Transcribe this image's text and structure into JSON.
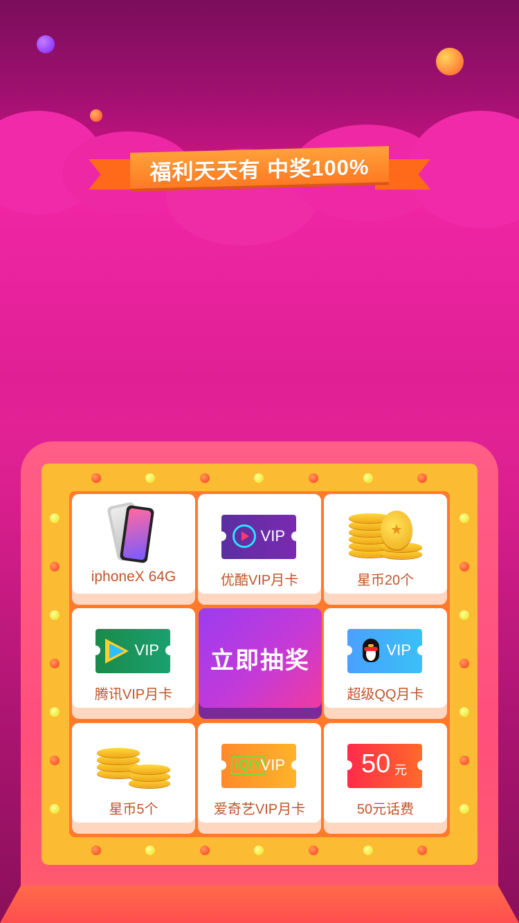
{
  "banner": {
    "text": "福利天天有 中奖100%"
  },
  "draw_button": {
    "label": "立即抽奖"
  },
  "prizes": [
    {
      "label": "iphoneX 64G",
      "icon": "iphone-icon"
    },
    {
      "label": "优酷VIP月卡",
      "icon": "youku-vip-ticket-icon",
      "badge": "VIP"
    },
    {
      "label": "星币20个",
      "icon": "coin-pile-icon"
    },
    {
      "label": "腾讯VIP月卡",
      "icon": "tencent-video-vip-ticket-icon",
      "badge": "VIP"
    },
    {
      "label": "超级QQ月卡",
      "icon": "qq-vip-ticket-icon",
      "badge": "VIP"
    },
    {
      "label": "星币5个",
      "icon": "coin-stack-icon"
    },
    {
      "label": "爱奇艺VIP月卡",
      "icon": "iqiyi-vip-ticket-icon",
      "badge": "VIP",
      "logo": "iQIY"
    },
    {
      "label": "50元话费",
      "icon": "phone-credit-ticket-icon",
      "amount": "50",
      "unit": "元"
    }
  ],
  "colors": {
    "background_top": "#7a0d5c",
    "background_mid": "#f02aa0",
    "ribbon": "#ff7a22",
    "board": "#fbbb33",
    "prize_text": "#c0542a",
    "draw_button": "#9b3cf0"
  }
}
